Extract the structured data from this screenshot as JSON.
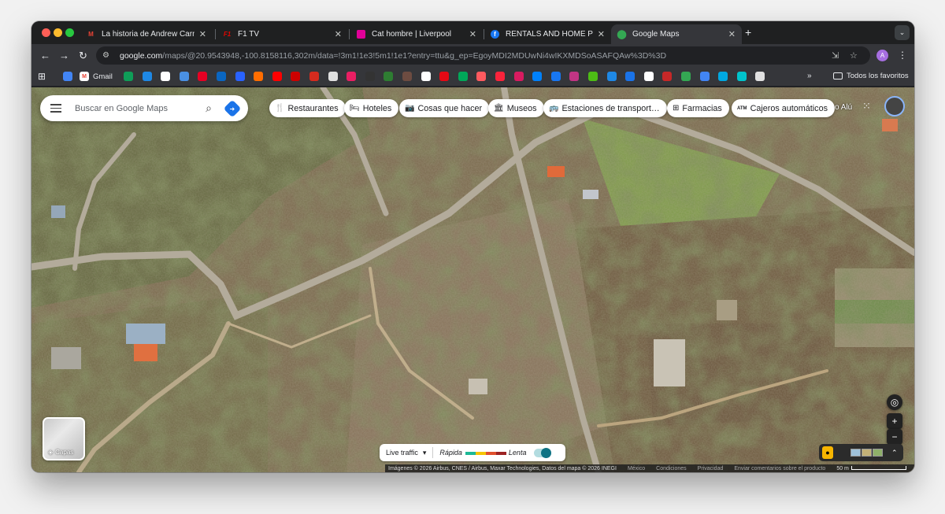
{
  "tabs": [
    {
      "title": "La historia de Andrew Carnegie",
      "favicon": "gmail-icon",
      "color": "#ea4335",
      "active": false
    },
    {
      "title": "F1 TV",
      "favicon": "f1-icon",
      "color": "#e10600",
      "active": false
    },
    {
      "title": "Cat hombre | Liverpool",
      "favicon": "liverpool-icon",
      "color": "#e10098",
      "active": false
    },
    {
      "title": "RENTALS AND HOME PROPERTIES",
      "favicon": "facebook-icon",
      "color": "#1877f2",
      "active": false
    },
    {
      "title": "Google Maps",
      "favicon": "maps-icon",
      "color": "#34a853",
      "active": true
    }
  ],
  "address": {
    "host": "google.com",
    "path": "/maps/@20.9543948,-100.8158116,302m/data=!3m1!1e3!5m1!1e1?entry=ttu&g_ep=EgoyMDI2MDUwNi4wIKXMDSoASAFQAw%3D%3D"
  },
  "profile_letter": "A",
  "bookmarks": {
    "gmail_label": "Gmail",
    "all_label": "Todos los favoritos",
    "icons": [
      {
        "name": "calendar-icon",
        "color": "#4285f4"
      },
      {
        "name": "drive-icon",
        "color": "#0f9d58"
      },
      {
        "name": "cloud-icon",
        "color": "#1e88e5"
      },
      {
        "name": "notion-icon",
        "color": "#ffffff"
      },
      {
        "name": "bookmark-icon",
        "color": "#4a90e2"
      },
      {
        "name": "pinterest-icon",
        "color": "#e60023"
      },
      {
        "name": "linkedin-icon",
        "color": "#0a66c2"
      },
      {
        "name": "pb-icon",
        "color": "#2962ff"
      },
      {
        "name": "tool-icon",
        "color": "#ff6d00"
      },
      {
        "name": "youtube-icon",
        "color": "#ff0000"
      },
      {
        "name": "target-icon",
        "color": "#cc0000"
      },
      {
        "name": "maple-icon",
        "color": "#d52b1e"
      },
      {
        "name": "clapper-icon",
        "color": "#e0e0e0"
      },
      {
        "name": "heart-icon",
        "color": "#e91e63"
      },
      {
        "name": "circle-icon",
        "color": "#333333"
      },
      {
        "name": "chart-icon",
        "color": "#2e7d32"
      },
      {
        "name": "wave-icon",
        "color": "#6d4c41"
      },
      {
        "name": "google-icon",
        "color": "#ffffff"
      },
      {
        "name": "netflix-icon",
        "color": "#e50914"
      },
      {
        "name": "retail-icon",
        "color": "#00a859"
      },
      {
        "name": "airbnb-icon",
        "color": "#ff5a5f"
      },
      {
        "name": "music-icon",
        "color": "#fa233b"
      },
      {
        "name": "stripe-icon",
        "color": "#d81b60"
      },
      {
        "name": "meta-icon",
        "color": "#0081fb"
      },
      {
        "name": "facebook-icon",
        "color": "#1877f2"
      },
      {
        "name": "instagram-icon",
        "color": "#c13584"
      },
      {
        "name": "houzz-icon",
        "color": "#4dbc15"
      },
      {
        "name": "photos-icon",
        "color": "#1e88e5"
      },
      {
        "name": "docs-icon",
        "color": "#1a73e8"
      },
      {
        "name": "google2-icon",
        "color": "#ffffff"
      },
      {
        "name": "news-icon",
        "color": "#c62828"
      },
      {
        "name": "maps-icon",
        "color": "#34a853"
      },
      {
        "name": "translate-icon",
        "color": "#4285f4"
      },
      {
        "name": "prime-icon",
        "color": "#00a8e1"
      },
      {
        "name": "canva-icon",
        "color": "#00c4cc"
      },
      {
        "name": "globe-icon",
        "color": "#e0e0e0"
      }
    ]
  },
  "maps": {
    "search_placeholder": "Buscar en Google Maps",
    "chips": [
      {
        "label": "Restaurantes",
        "icon": "fork-knife-icon"
      },
      {
        "label": "Hoteles",
        "icon": "bed-icon"
      },
      {
        "label": "Cosas que hacer",
        "icon": "camera-icon"
      },
      {
        "label": "Museos",
        "icon": "museum-icon"
      },
      {
        "label": "Estaciones de transport…",
        "icon": "bus-icon"
      },
      {
        "label": "Farmacias",
        "icon": "pharmacy-icon"
      },
      {
        "label": "Cajeros automáticos",
        "icon": "atm-icon"
      }
    ],
    "overflow_text": "o Alú",
    "layers_label": "Capas",
    "traffic": {
      "live": "Live traffic",
      "fast": "Rápida",
      "slow": "Lenta",
      "colors": [
        "#1db896",
        "#f5c400",
        "#e0502c",
        "#9c2222"
      ]
    },
    "footer": {
      "attribution": "Imágenes © 2026 Airbus, CNES / Airbus, Maxar Technologies, Datos del mapa © 2026 INEGI",
      "country": "México",
      "terms": "Condiciones",
      "privacy": "Privacidad",
      "feedback": "Enviar comentarios sobre el producto",
      "scale": "50 m"
    }
  }
}
